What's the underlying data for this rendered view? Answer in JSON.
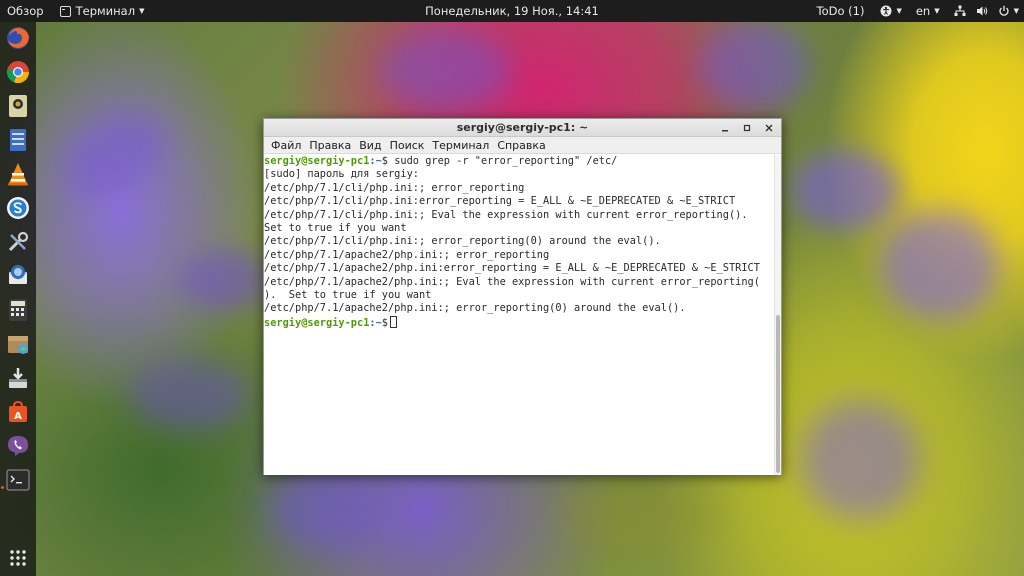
{
  "topbar": {
    "overview": "Обзор",
    "app_menu": "Терминал",
    "clock": "Понедельник, 19 Ноя., 14:41",
    "todo": "ToDo (1)",
    "lang": "en"
  },
  "dock": {
    "items": [
      "firefox-icon",
      "chrome-icon",
      "notes-icon",
      "files-icon",
      "vlc-icon",
      "skype-icon",
      "tools-icon",
      "thunderbird-icon",
      "calculator-icon",
      "archive-icon",
      "installer-icon",
      "software-center-icon",
      "viber-icon",
      "terminal-icon",
      "show-apps-icon"
    ]
  },
  "window": {
    "title": "sergiy@sergiy-pc1: ~",
    "menu": [
      "Файл",
      "Правка",
      "Вид",
      "Поиск",
      "Терминал",
      "Справка"
    ]
  },
  "terminal": {
    "prompt_user": "sergiy@sergiy-pc1",
    "prompt_path": ":~",
    "command_line": "$ sudo grep -r \"error_reporting\" /etc/",
    "lines": [
      "[sudo] пароль для sergiy:",
      "/etc/php/7.1/cli/php.ini:; error_reporting",
      "/etc/php/7.1/cli/php.ini:error_reporting = E_ALL & ~E_DEPRECATED & ~E_STRICT",
      "/etc/php/7.1/cli/php.ini:; Eval the expression with current error_reporting().",
      "Set to true if you want",
      "/etc/php/7.1/cli/php.ini:; error_reporting(0) around the eval().",
      "/etc/php/7.1/apache2/php.ini:; error_reporting",
      "/etc/php/7.1/apache2/php.ini:error_reporting = E_ALL & ~E_DEPRECATED & ~E_STRICT",
      "/etc/php/7.1/apache2/php.ini:; Eval the expression with current error_reporting(",
      ").  Set to true if you want",
      "/etc/php/7.1/apache2/php.ini:; error_reporting(0) around the eval()."
    ],
    "final_prompt_symbol": "$"
  },
  "colors": {
    "topbar_bg": "#1d1d1d",
    "prompt_user": "#4e9a06",
    "prompt_path": "#3465a4",
    "dock_indicator": "#e95420"
  }
}
